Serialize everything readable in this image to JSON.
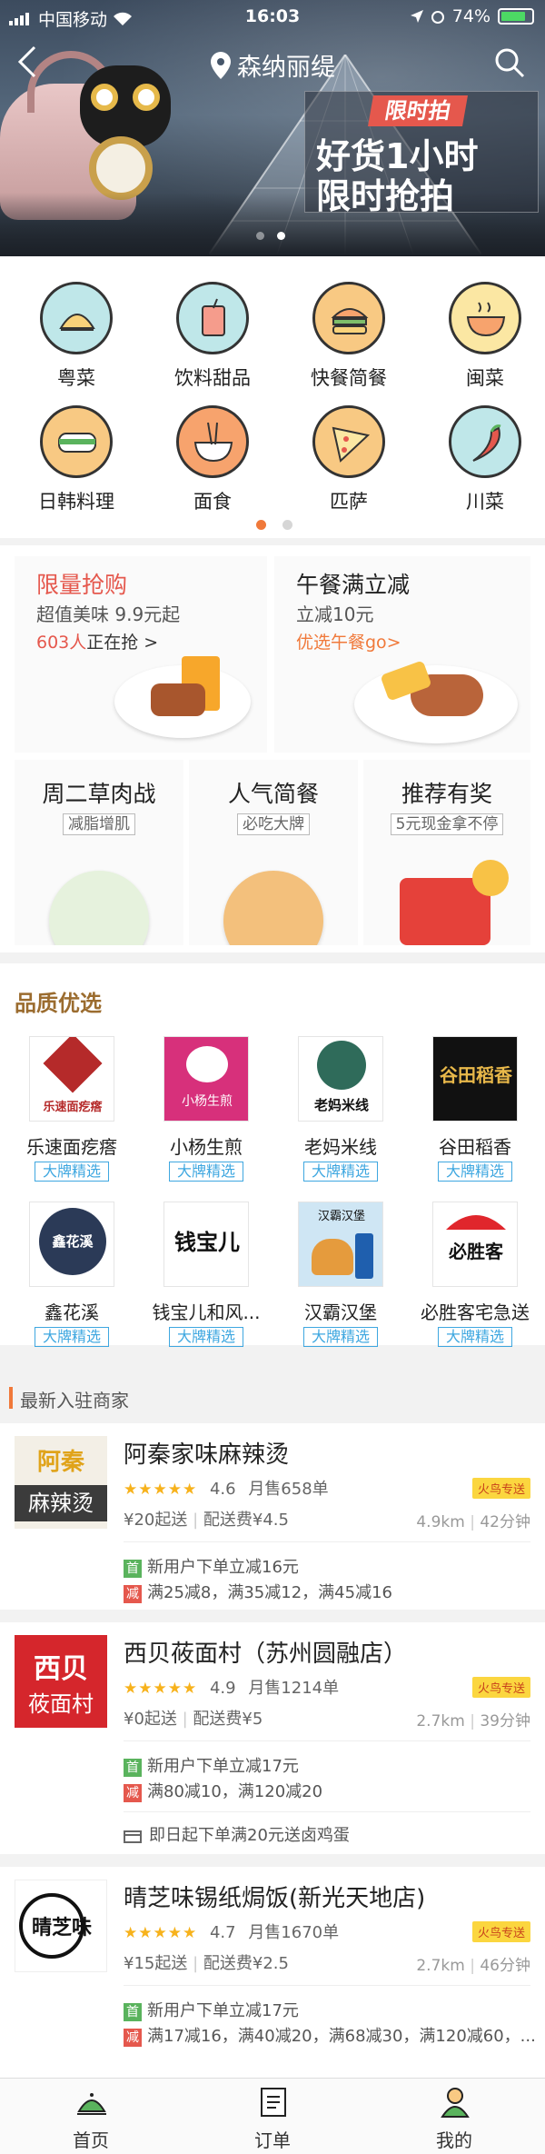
{
  "status": {
    "carrier": "中国移动",
    "time": "16:03",
    "battery": "74%"
  },
  "nav": {
    "location": "森纳丽缇"
  },
  "banner": {
    "tag": "限时拍",
    "line1": "好货1小时",
    "line2": "限时抢拍"
  },
  "categories": [
    {
      "label": "粤菜",
      "icon": "dumpling-icon",
      "bg": "#bfe7e9"
    },
    {
      "label": "饮料甜品",
      "icon": "drink-icon",
      "bg": "#bfe7e9"
    },
    {
      "label": "快餐简餐",
      "icon": "burger-icon",
      "bg": "#f8c983"
    },
    {
      "label": "闽菜",
      "icon": "soup-bowl-icon",
      "bg": "#fbe7a3"
    },
    {
      "label": "日韩料理",
      "icon": "sushi-icon",
      "bg": "#f8c983"
    },
    {
      "label": "面食",
      "icon": "noodle-icon",
      "bg": "#f7a36d"
    },
    {
      "label": "匹萨",
      "icon": "pizza-icon",
      "bg": "#f8c983"
    },
    {
      "label": "川菜",
      "icon": "chili-icon",
      "bg": "#bfe7e9"
    }
  ],
  "promos": {
    "flash": {
      "title": "限量抢购",
      "subtitle": "超值美味 9.9元起",
      "count": "603人",
      "count_suffix": "正在抢 >"
    },
    "lunch": {
      "title": "午餐满立减",
      "subtitle": "立减10元",
      "link": "优选午餐go>"
    },
    "small": [
      {
        "title": "周二草肉战",
        "tag": "减脂增肌"
      },
      {
        "title": "人气简餐",
        "tag": "必吃大牌"
      },
      {
        "title": "推荐有奖",
        "tag": "5元现金拿不停"
      }
    ]
  },
  "quality": {
    "title": "品质优选",
    "badge": "大牌精选",
    "brands": [
      {
        "name": "乐速面疙瘩",
        "logo_text": "乐速面疙瘩"
      },
      {
        "name": "小杨生煎",
        "logo_text": "小杨生煎"
      },
      {
        "name": "老妈米线",
        "logo_text": "老妈米线"
      },
      {
        "name": "谷田稻香",
        "logo_text": "谷田稻香"
      },
      {
        "name": "鑫花溪",
        "logo_text": "鑫花溪"
      },
      {
        "name": "钱宝儿和风...",
        "logo_text": "钱宝儿"
      },
      {
        "name": "汉霸汉堡",
        "logo_text": "汉霸汉堡"
      },
      {
        "name": "必胜客宅急送",
        "logo_text": "必胜客"
      }
    ]
  },
  "new_merchants": {
    "title": "最新入驻商家",
    "shops": [
      {
        "name": "阿秦家味麻辣烫",
        "logo_line1": "阿秦",
        "logo_line2": "麻辣烫",
        "stars": "★★★★★",
        "rating": "4.6",
        "sales": "月售658单",
        "delivery": "火鸟专送",
        "min": "¥20起送",
        "fee": "配送费¥4.5",
        "distance": "4.9km",
        "time": "42分钟",
        "offer1": "新用户下单立减16元",
        "offer2": "满25减8，满35减12，满45减16",
        "extra": ""
      },
      {
        "name": "西贝莜面村（苏州圆融店）",
        "logo_line1": "西贝",
        "logo_line2": "莜面村",
        "stars": "★★★★★",
        "rating": "4.9",
        "sales": "月售1214单",
        "delivery": "火鸟专送",
        "min": "¥0起送",
        "fee": "配送费¥5",
        "distance": "2.7km",
        "time": "39分钟",
        "offer1": "新用户下单立减17元",
        "offer2": "满80减10，满120减20",
        "extra": "即日起下单满20元送卤鸡蛋"
      },
      {
        "name": "晴芝味锡纸焗饭(新光天地店)",
        "logo_line1": "晴芝味",
        "logo_line2": "",
        "stars": "★★★★★",
        "rating": "4.7",
        "sales": "月售1670单",
        "delivery": "火鸟专送",
        "min": "¥15起送",
        "fee": "配送费¥2.5",
        "distance": "2.7km",
        "time": "46分钟",
        "offer1": "新用户下单立减17元",
        "offer2": "满17减16，满40减20，满68减30，满120减60，...",
        "extra": ""
      }
    ]
  },
  "tabs": [
    {
      "label": "首页"
    },
    {
      "label": "订单"
    },
    {
      "label": "我的"
    }
  ],
  "colors": {
    "accent": "#f0793a",
    "red": "#e5584d",
    "brand_blue": "#3ea7e0",
    "gold": "#9b6c2f"
  }
}
